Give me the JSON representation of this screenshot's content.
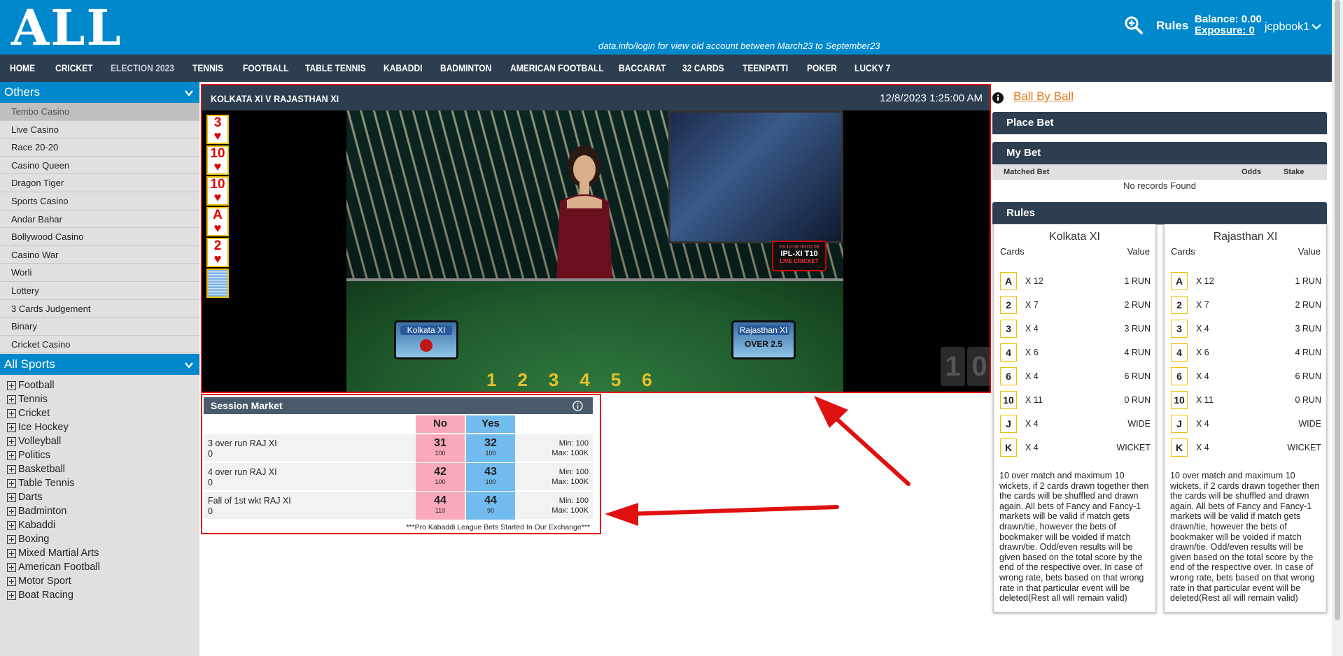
{
  "header": {
    "logo": "ALL",
    "marquee": "data.info/login for view old account between March23 to September23",
    "rules_label": "Rules",
    "balance_label": "Balance:",
    "balance_value": "0.00",
    "exposure_label": "Exposure:",
    "exposure_value": "0",
    "username": "jcpbook1"
  },
  "nav": [
    "HOME",
    "CRICKET",
    "ELECTION 2023",
    "TENNIS",
    "FOOTBALL",
    "TABLE TENNIS",
    "KABADDI",
    "BADMINTON",
    "AMERICAN FOOTBALL",
    "BACCARAT",
    "32 CARDS",
    "TEENPATTI",
    "POKER",
    "LUCKY 7"
  ],
  "sidebar": {
    "others_title": "Others",
    "casino_items": [
      "Tembo Casino",
      "Live Casino",
      "Race 20-20",
      "Casino Queen",
      "Dragon Tiger",
      "Sports Casino",
      "Andar Bahar",
      "Bollywood Casino",
      "Casino War",
      "Worli",
      "Lottery",
      "3 Cards Judgement",
      "Binary",
      "Cricket Casino"
    ],
    "all_sports_title": "All Sports",
    "sports": [
      "Football",
      "Tennis",
      "Cricket",
      "Ice Hockey",
      "Volleyball",
      "Politics",
      "Basketball",
      "Table Tennis",
      "Darts",
      "Badminton",
      "Kabaddi",
      "Boxing",
      "Mixed Martial Arts",
      "American Football",
      "Motor Sport",
      "Boat Racing"
    ]
  },
  "video": {
    "title": "KOLKATA XI V RAJASTHAN XI",
    "datetime": "12/8/2023 1:25:00 AM",
    "cards": [
      {
        "rank": "3",
        "suit": "♥"
      },
      {
        "rank": "10",
        "suit": "♥"
      },
      {
        "rank": "10",
        "suit": "♥"
      },
      {
        "rank": "A",
        "suit": "♥"
      },
      {
        "rank": "2",
        "suit": "♥"
      }
    ],
    "overlay_date": "23-12-08 03:01:03",
    "overlay_title": "IPL-XI  T10",
    "overlay_sub": "LIVE CRICKET",
    "team_left": "Kolkata XI",
    "team_right": "Rajasthan XI",
    "over_text": "OVER 2.5",
    "slot_numbers": "123456",
    "timer_digits": [
      "1",
      "0"
    ]
  },
  "session": {
    "title": "Session Market",
    "no_label": "No",
    "yes_label": "Yes",
    "rows": [
      {
        "name": "3 over run RAJ XI",
        "sub": "0",
        "no": "31",
        "no_size": "100",
        "yes": "32",
        "yes_size": "100",
        "min": "Min: 100",
        "max": "Max: 100K"
      },
      {
        "name": "4 over run RAJ XI",
        "sub": "0",
        "no": "42",
        "no_size": "100",
        "yes": "43",
        "yes_size": "100",
        "min": "Min: 100",
        "max": "Max: 100K"
      },
      {
        "name": "Fall of 1st wkt RAJ XI",
        "sub": "0",
        "no": "44",
        "no_size": "110",
        "yes": "44",
        "yes_size": "90",
        "min": "Min: 100",
        "max": "Max: 100K"
      }
    ],
    "footer": "***Pro Kabaddi League Bets Started In Our Exchange***"
  },
  "right": {
    "ball_by_ball": "Ball By Ball",
    "place_bet": "Place Bet",
    "my_bet": "My Bet",
    "matched_bet": "Matched Bet",
    "odds": "Odds",
    "stake": "Stake",
    "no_records": "No records Found",
    "rules_title": "Rules",
    "cards_label": "Cards",
    "value_label": "Value",
    "teams": [
      {
        "name": "Kolkata XI",
        "rows": [
          {
            "card": "A",
            "mult": "X   12",
            "value": "1 RUN"
          },
          {
            "card": "2",
            "mult": "X   7",
            "value": "2 RUN"
          },
          {
            "card": "3",
            "mult": "X   4",
            "value": "3 RUN"
          },
          {
            "card": "4",
            "mult": "X   6",
            "value": "4 RUN"
          },
          {
            "card": "6",
            "mult": "X   4",
            "value": "6 RUN"
          },
          {
            "card": "10",
            "mult": "X   11",
            "value": "0 RUN"
          },
          {
            "card": "J",
            "mult": "X   4",
            "value": "WIDE"
          },
          {
            "card": "K",
            "mult": "X   4",
            "value": "WICKET"
          }
        ],
        "text": "10 over match and maximum 10 wickets, if 2 cards drawn together then the cards will be shuffled and drawn again. All bets of Fancy and Fancy-1 markets will be valid if match gets drawn/tie, however the bets of bookmaker will be voided if match drawn/tie. Odd/even results will be given based on the total score by the end of the respective over. In case of wrong rate, bets based on that wrong rate in that particular event will be deleted(Rest all will remain valid)"
      },
      {
        "name": "Rajasthan XI",
        "rows": [
          {
            "card": "A",
            "mult": "X   12",
            "value": "1 RUN"
          },
          {
            "card": "2",
            "mult": "X   7",
            "value": "2 RUN"
          },
          {
            "card": "3",
            "mult": "X   4",
            "value": "3 RUN"
          },
          {
            "card": "4",
            "mult": "X   6",
            "value": "4 RUN"
          },
          {
            "card": "6",
            "mult": "X   4",
            "value": "6 RUN"
          },
          {
            "card": "10",
            "mult": "X   11",
            "value": "0 RUN"
          },
          {
            "card": "J",
            "mult": "X   4",
            "value": "WIDE"
          },
          {
            "card": "K",
            "mult": "X   4",
            "value": "WICKET"
          }
        ],
        "text": "10 over match and maximum 10 wickets, if 2 cards drawn together then the cards will be shuffled and drawn again. All bets of Fancy and Fancy-1 markets will be valid if match gets drawn/tie, however the bets of bookmaker will be voided if match drawn/tie. Odd/even results will be given based on the total score by the end of the respective over. In case of wrong rate, bets based on that wrong rate in that particular event will be deleted(Rest all will remain valid)"
      }
    ]
  },
  "colors": {
    "brand_blue": "#0088cc",
    "nav_dark": "#2c3e50",
    "lay_pink": "#faa9ba",
    "back_blue": "#72bbef",
    "highlight_red": "#e01010",
    "link_orange": "#e07b1a"
  }
}
